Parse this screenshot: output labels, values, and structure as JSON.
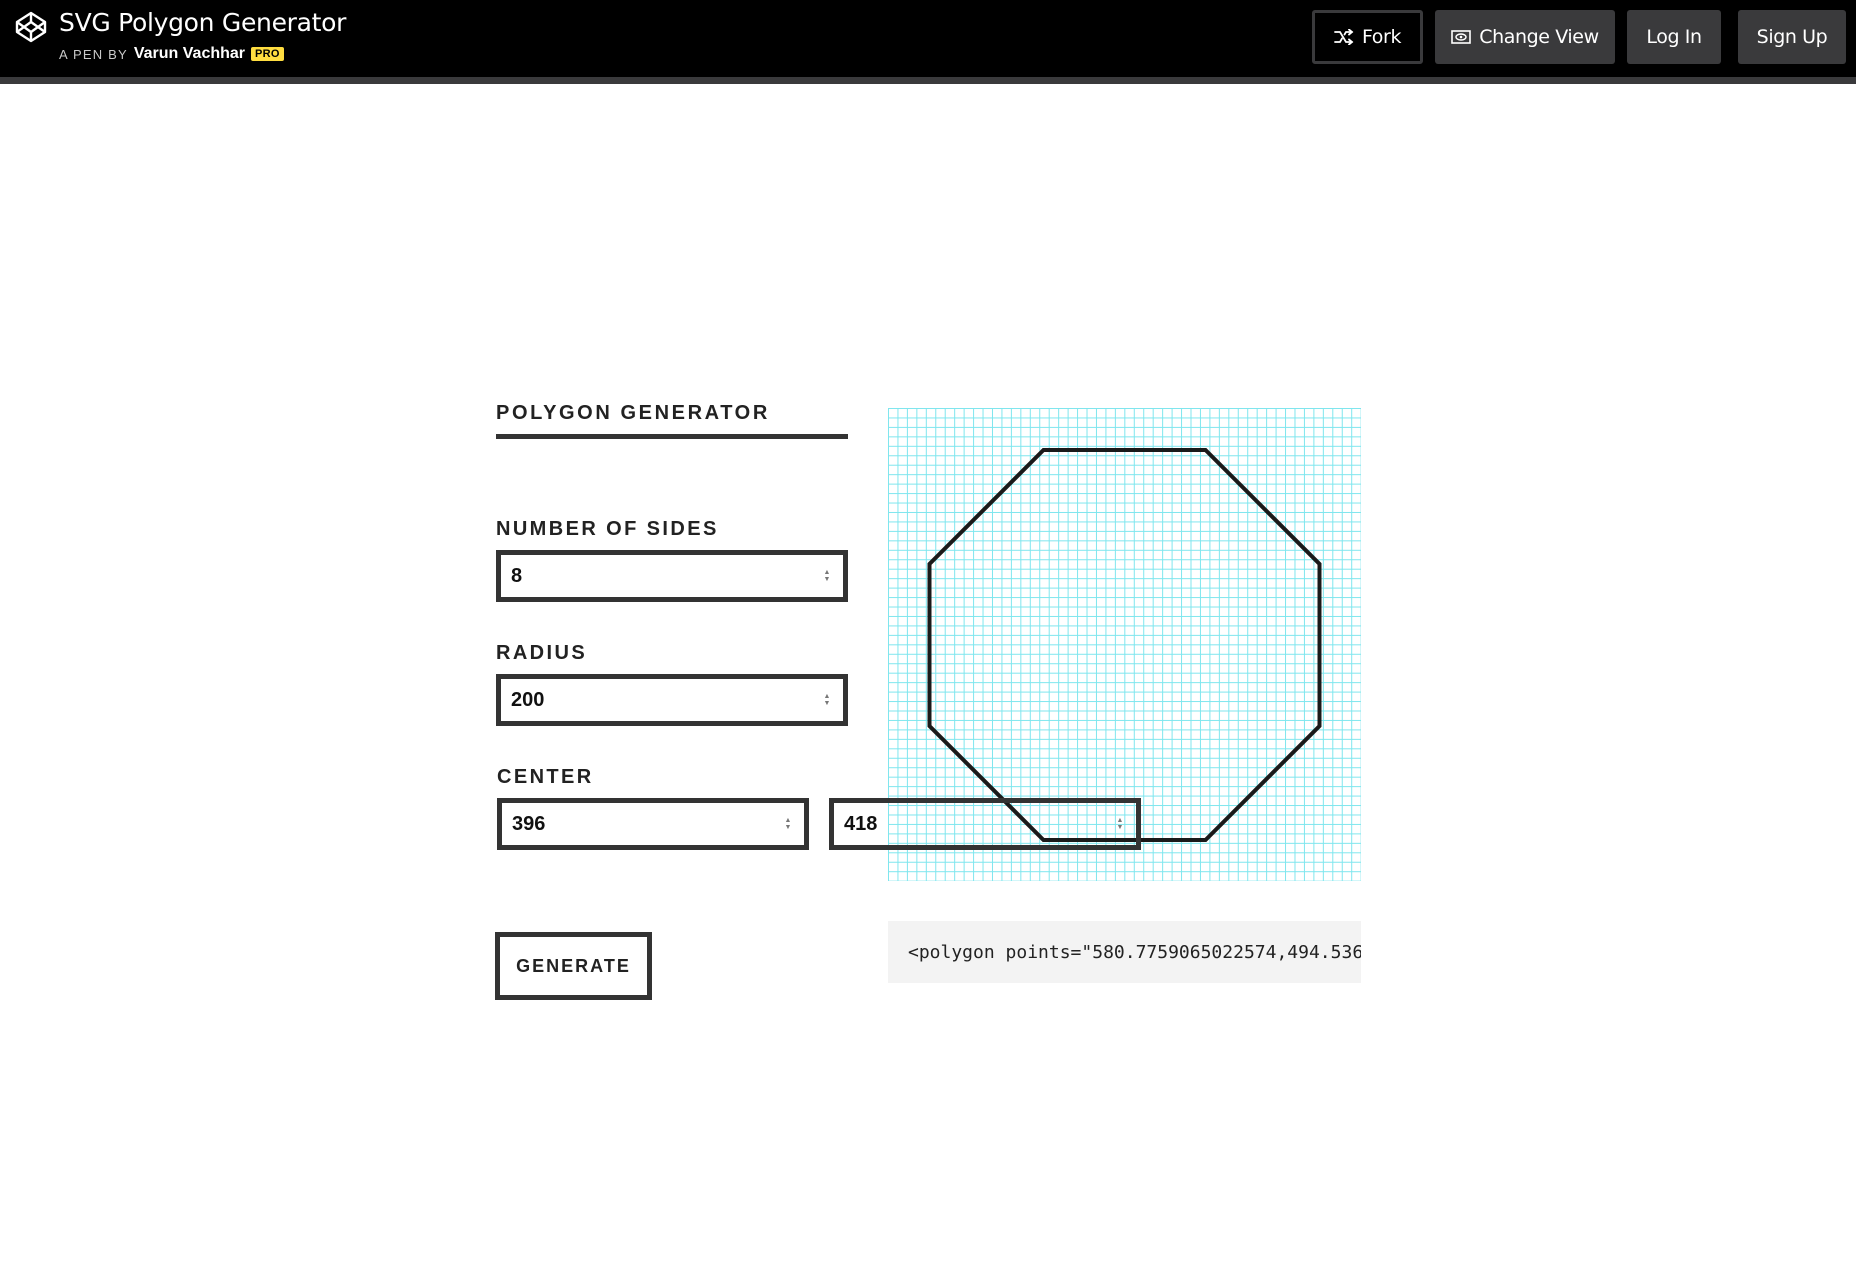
{
  "header": {
    "title": "SVG Polygon Generator",
    "byline": "A PEN BY",
    "author": "Varun Vachhar",
    "badge": "PRO",
    "buttons": {
      "fork": "Fork",
      "change_view": "Change View",
      "login": "Log In",
      "signup": "Sign Up"
    },
    "icons": {
      "logo": "codepen-logo-icon",
      "fork": "fork-icon",
      "change_view": "eye-window-icon"
    }
  },
  "form": {
    "title": "POLYGON GENERATOR",
    "sides_label": "NUMBER OF SIDES",
    "sides_value": "8",
    "radius_label": "RADIUS",
    "radius_value": "200",
    "center_label": "CENTER",
    "center_x": "396",
    "center_y": "418",
    "generate_label": "GENERATE"
  },
  "output": {
    "text": "<polygon points=\"580.7759065022574,494.536"
  },
  "colors": {
    "header_bg": "#000000",
    "button_bg": "#3a3a3c",
    "grid_line": "#7fe6ee",
    "badge": "#ffdd40"
  }
}
